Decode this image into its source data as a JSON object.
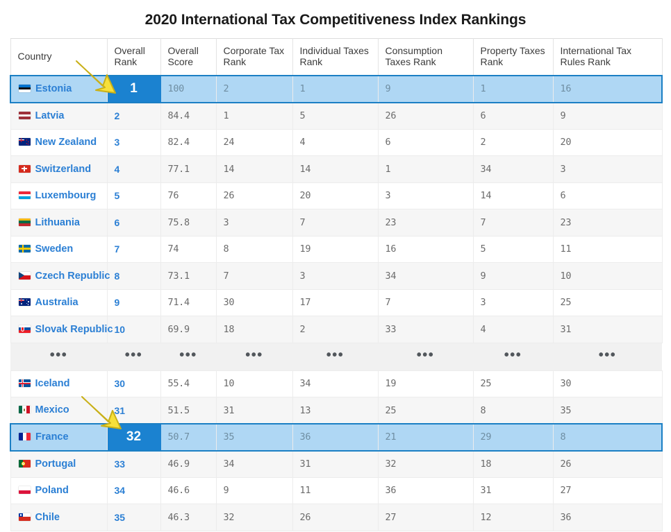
{
  "page": {
    "title": "2020 International Tax Competitiveness Index Rankings"
  },
  "table": {
    "columns": [
      {
        "key": "country",
        "label_line1": "Country",
        "label_line2": ""
      },
      {
        "key": "rank",
        "label_line1": "Overall",
        "label_line2": "Rank"
      },
      {
        "key": "score",
        "label_line1": "Overall",
        "label_line2": "Score"
      },
      {
        "key": "corp",
        "label_line1": "Corporate Tax",
        "label_line2": "Rank"
      },
      {
        "key": "indiv",
        "label_line1": "Individual Taxes",
        "label_line2": "Rank"
      },
      {
        "key": "consum",
        "label_line1": "Consumption",
        "label_line2": "Taxes Rank"
      },
      {
        "key": "prop",
        "label_line1": "Property Taxes",
        "label_line2": "Rank"
      },
      {
        "key": "intl",
        "label_line1": "International Tax",
        "label_line2": "Rules Rank"
      }
    ],
    "ellipsis_symbol": "•••",
    "rows": [
      {
        "country": "Estonia",
        "flag": "flag-estonia",
        "rank": "1",
        "score": "100",
        "corp": "2",
        "indiv": "1",
        "consum": "9",
        "prop": "1",
        "intl": "16",
        "highlighted": true
      },
      {
        "country": "Latvia",
        "flag": "flag-latvia",
        "rank": "2",
        "score": "84.4",
        "corp": "1",
        "indiv": "5",
        "consum": "26",
        "prop": "6",
        "intl": "9",
        "highlighted": false
      },
      {
        "country": "New Zealand",
        "flag": "flag-new-zealand",
        "rank": "3",
        "score": "82.4",
        "corp": "24",
        "indiv": "4",
        "consum": "6",
        "prop": "2",
        "intl": "20",
        "highlighted": false
      },
      {
        "country": "Switzerland",
        "flag": "flag-switzerland",
        "rank": "4",
        "score": "77.1",
        "corp": "14",
        "indiv": "14",
        "consum": "1",
        "prop": "34",
        "intl": "3",
        "highlighted": false
      },
      {
        "country": "Luxembourg",
        "flag": "flag-luxembourg",
        "rank": "5",
        "score": "76",
        "corp": "26",
        "indiv": "20",
        "consum": "3",
        "prop": "14",
        "intl": "6",
        "highlighted": false
      },
      {
        "country": "Lithuania",
        "flag": "flag-lithuania",
        "rank": "6",
        "score": "75.8",
        "corp": "3",
        "indiv": "7",
        "consum": "23",
        "prop": "7",
        "intl": "23",
        "highlighted": false
      },
      {
        "country": "Sweden",
        "flag": "flag-sweden",
        "rank": "7",
        "score": "74",
        "corp": "8",
        "indiv": "19",
        "consum": "16",
        "prop": "5",
        "intl": "11",
        "highlighted": false
      },
      {
        "country": "Czech Republic",
        "flag": "flag-czech-republic",
        "rank": "8",
        "score": "73.1",
        "corp": "7",
        "indiv": "3",
        "consum": "34",
        "prop": "9",
        "intl": "10",
        "highlighted": false
      },
      {
        "country": "Australia",
        "flag": "flag-australia",
        "rank": "9",
        "score": "71.4",
        "corp": "30",
        "indiv": "17",
        "consum": "7",
        "prop": "3",
        "intl": "25",
        "highlighted": false
      },
      {
        "country": "Slovak Republic",
        "flag": "flag-slovak-republic",
        "rank": "10",
        "score": "69.9",
        "corp": "18",
        "indiv": "2",
        "consum": "33",
        "prop": "4",
        "intl": "31",
        "highlighted": false
      },
      {
        "country": "Iceland",
        "flag": "flag-iceland",
        "rank": "30",
        "score": "55.4",
        "corp": "10",
        "indiv": "34",
        "consum": "19",
        "prop": "25",
        "intl": "30",
        "highlighted": false
      },
      {
        "country": "Mexico",
        "flag": "flag-mexico",
        "rank": "31",
        "score": "51.5",
        "corp": "31",
        "indiv": "13",
        "consum": "25",
        "prop": "8",
        "intl": "35",
        "highlighted": false
      },
      {
        "country": "France",
        "flag": "flag-france",
        "rank": "32",
        "score": "50.7",
        "corp": "35",
        "indiv": "36",
        "consum": "21",
        "prop": "29",
        "intl": "8",
        "highlighted": true
      },
      {
        "country": "Portugal",
        "flag": "flag-portugal",
        "rank": "33",
        "score": "46.9",
        "corp": "34",
        "indiv": "31",
        "consum": "32",
        "prop": "18",
        "intl": "26",
        "highlighted": false
      },
      {
        "country": "Poland",
        "flag": "flag-poland",
        "rank": "34",
        "score": "46.6",
        "corp": "9",
        "indiv": "11",
        "consum": "36",
        "prop": "31",
        "intl": "27",
        "highlighted": false
      },
      {
        "country": "Chile",
        "flag": "flag-chile",
        "rank": "35",
        "score": "46.3",
        "corp": "32",
        "indiv": "26",
        "consum": "27",
        "prop": "12",
        "intl": "36",
        "highlighted": false
      }
    ],
    "ellipsis_after_row_index": 9
  },
  "annotations": [
    {
      "name": "arrow-pointing-to-estonia-overall-rank",
      "icon": "arrow-icon",
      "target": "Estonia Overall Rank 1"
    },
    {
      "name": "arrow-pointing-to-france-overall-rank",
      "icon": "arrow-icon",
      "target": "France Overall Rank 32"
    }
  ],
  "colors": {
    "link_blue": "#2b7fd4",
    "highlight_row_bg": "#afd7f4",
    "highlight_rank_bg": "#1b82d0",
    "highlight_border": "#1b7fc4",
    "arrow_fill": "#f7e03a",
    "arrow_stroke": "#c9b018",
    "alt_row_bg": "#f6f6f6",
    "ellipsis_row_bg": "#f1f1f1"
  }
}
